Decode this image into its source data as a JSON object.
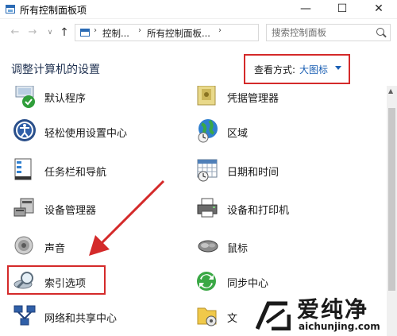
{
  "window": {
    "title": "所有控制面板项",
    "minimize_glyph": "—",
    "maximize_glyph": "☐",
    "close_glyph": "✕"
  },
  "address": {
    "back_glyph": "←",
    "forward_glyph": "→",
    "recent_glyph": "∨",
    "up_glyph": "↑",
    "sep1": "›",
    "crumb1": "控制...",
    "sep2": "›",
    "crumb2": "所有控制面板...",
    "sep3": "›",
    "dropdown_glyph": "∨",
    "refresh_glyph": "↻",
    "search_placeholder": "搜索控制面板"
  },
  "header": {
    "title": "调整计算机的设置",
    "view_by_label": "查看方式:",
    "view_by_value": "大图标"
  },
  "items": [
    {
      "label": "默认程序",
      "icon": "default-programs-icon"
    },
    {
      "label": "凭据管理器",
      "icon": "credential-manager-icon"
    },
    {
      "label": "轻松使用设置中心",
      "icon": "ease-of-access-icon"
    },
    {
      "label": "区域",
      "icon": "region-globe-icon"
    },
    {
      "label": "任务栏和导航",
      "icon": "taskbar-icon"
    },
    {
      "label": "日期和时间",
      "icon": "date-time-icon"
    },
    {
      "label": "设备管理器",
      "icon": "device-manager-icon"
    },
    {
      "label": "设备和打印机",
      "icon": "printer-icon"
    },
    {
      "label": "声音",
      "icon": "speaker-icon"
    },
    {
      "label": "鼠标",
      "icon": "mouse-icon"
    },
    {
      "label": "索引选项",
      "icon": "indexing-magnifier-icon"
    },
    {
      "label": "同步中心",
      "icon": "sync-center-icon"
    },
    {
      "label": "网络和共享中心",
      "icon": "network-icon"
    },
    {
      "label": "文",
      "icon": "file-explorer-options-icon"
    }
  ],
  "watermark": {
    "title": "爱纯净",
    "url": "aichunjing.com"
  },
  "colors": {
    "highlight_red": "#d42a2a",
    "link_blue": "#1a5fb4"
  }
}
